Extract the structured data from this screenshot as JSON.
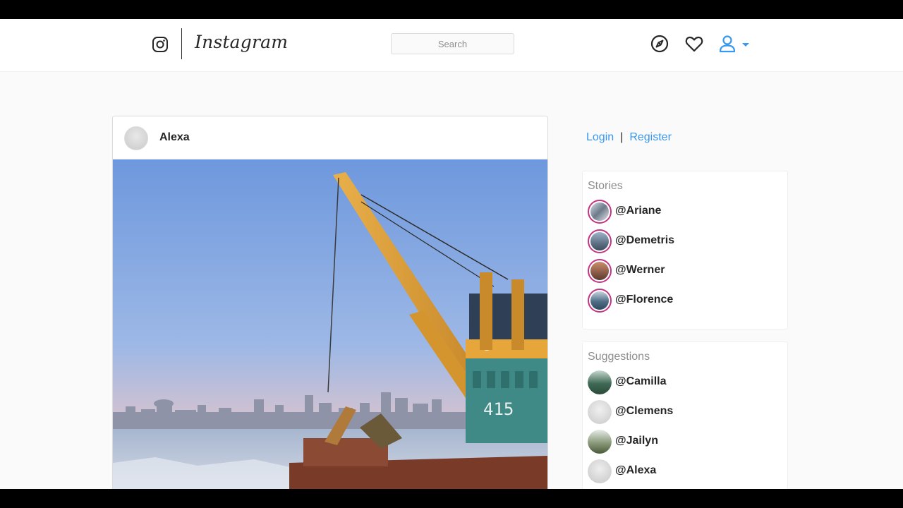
{
  "header": {
    "logo_text": "Instagram",
    "search_placeholder": "Search",
    "icons": [
      "instagram-glyph-icon",
      "explore-compass-icon",
      "heart-icon",
      "user-profile-icon",
      "caret-down-icon"
    ]
  },
  "post": {
    "username": "Alexa",
    "image_alt": "Harbor crane on icy river at sunset with city skyline",
    "crane_number": "415"
  },
  "auth": {
    "login_label": "Login",
    "separator": "|",
    "register_label": "Register"
  },
  "stories": {
    "title": "Stories",
    "items": [
      "@Ariane",
      "@Demetris",
      "@Werner",
      "@Florence"
    ]
  },
  "suggestions": {
    "title": "Suggestions",
    "items": [
      "@Camilla",
      "@Clemens",
      "@Jailyn",
      "@Alexa"
    ]
  },
  "colors": {
    "link": "#3897f0",
    "story_ring": "#c13584",
    "text": "#262626",
    "muted": "#8e8e8e"
  }
}
